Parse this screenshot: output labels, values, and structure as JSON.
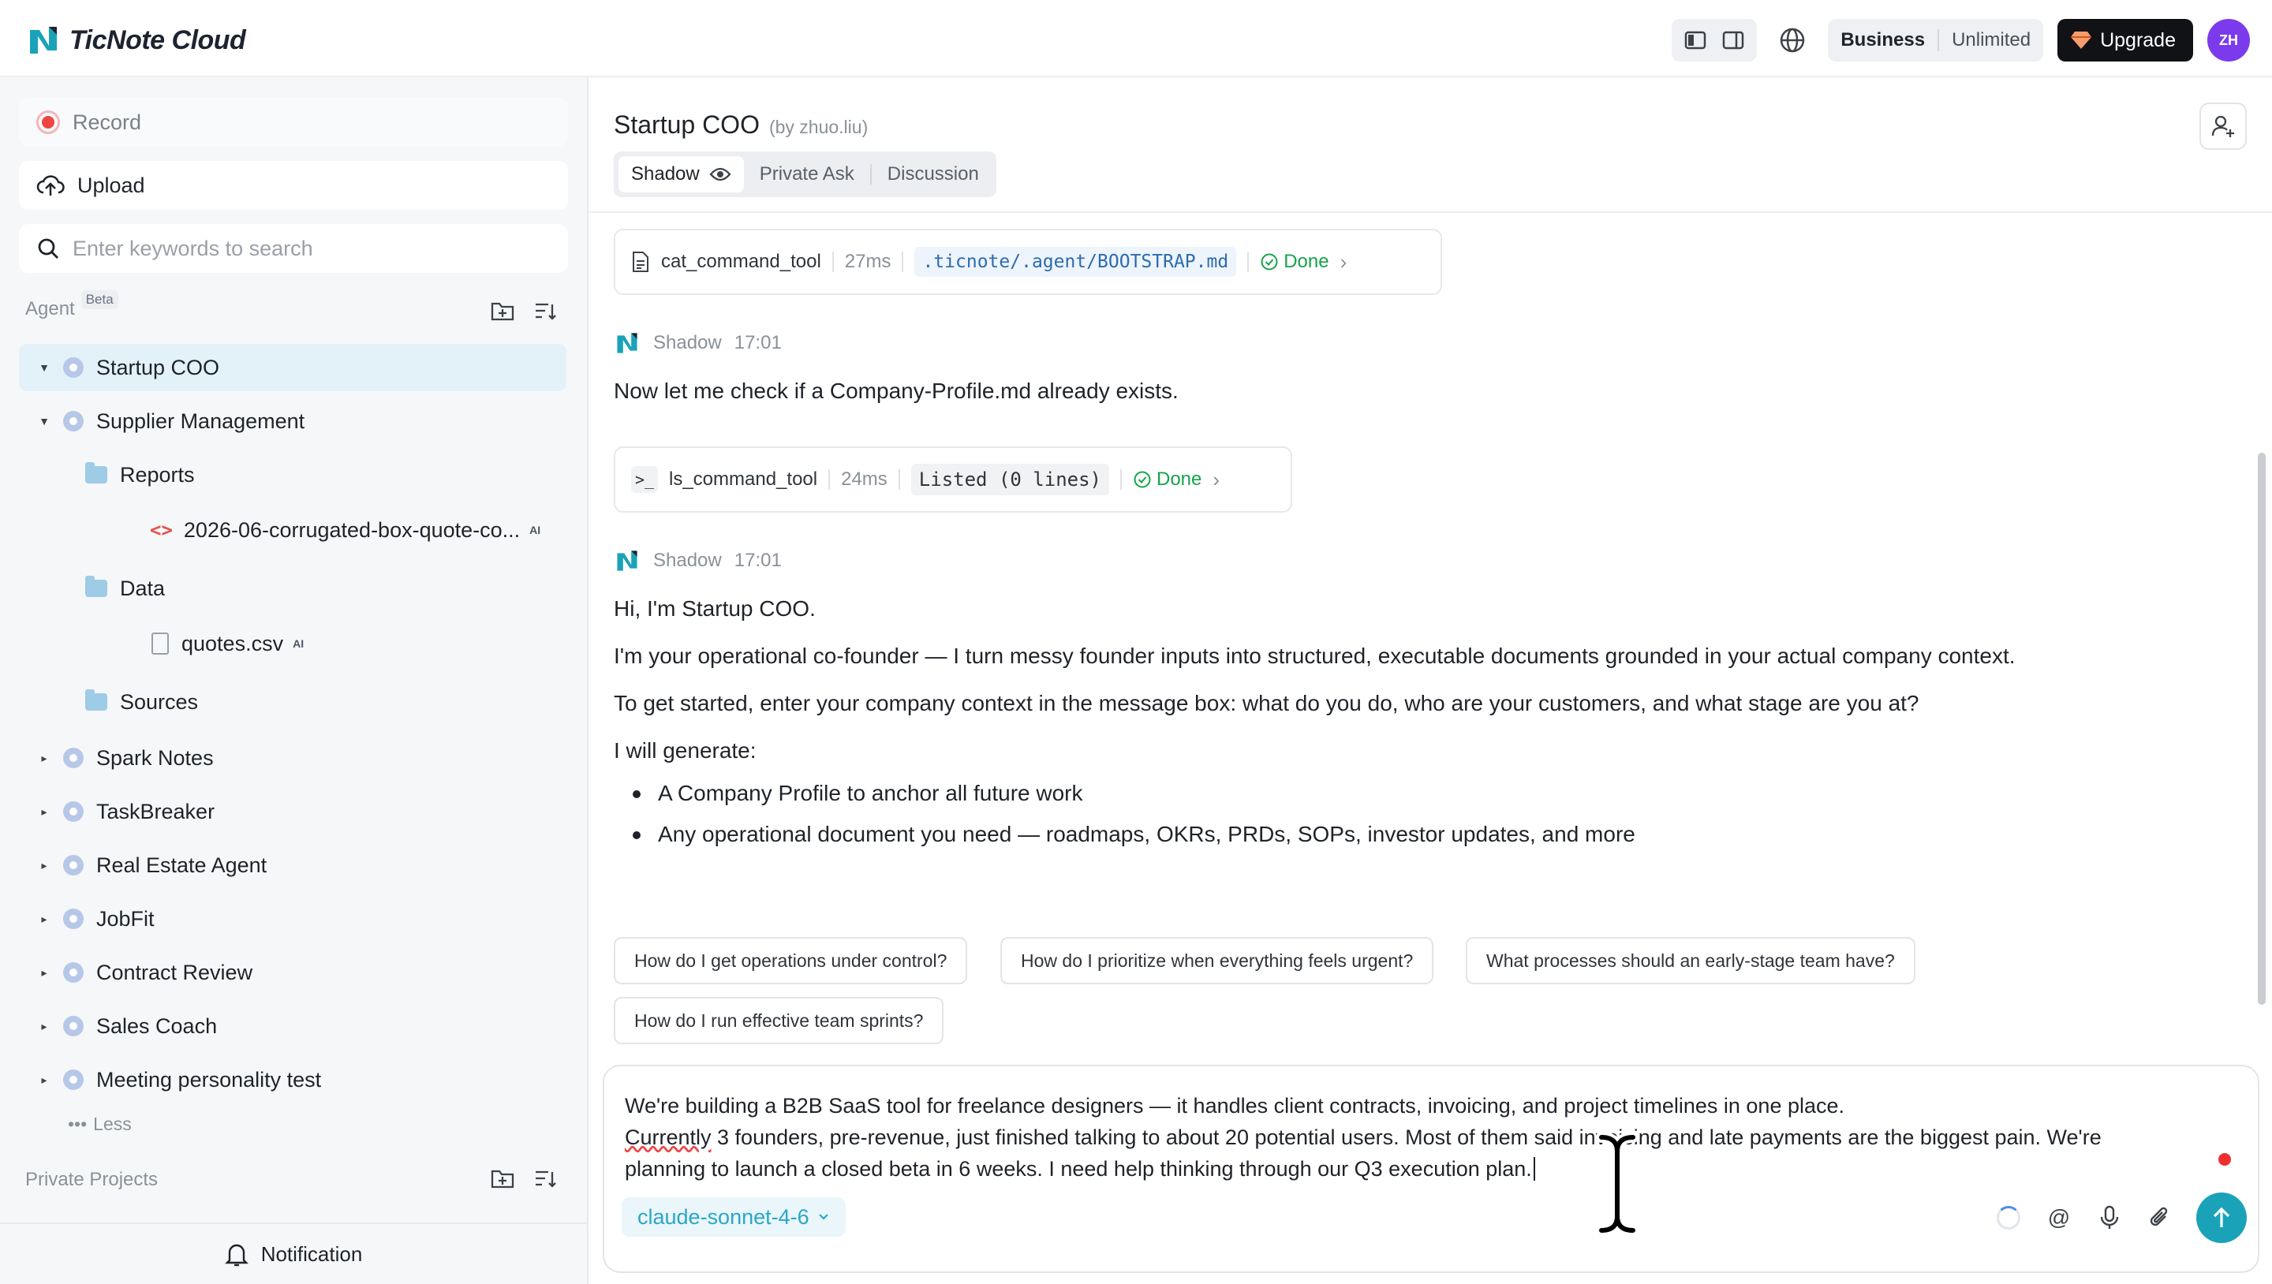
{
  "app": {
    "logo_text": "TicNote Cloud",
    "accent_color": "#1aa3b8"
  },
  "topbar": {
    "plan": "Business",
    "plan_tier": "Unlimited",
    "upgrade_label": "Upgrade",
    "avatar_initials": "ZH"
  },
  "sidebar": {
    "record_label": "Record",
    "upload_label": "Upload",
    "search_placeholder": "Enter keywords to search",
    "agent_section": "Agent",
    "beta_badge": "Beta",
    "tree": [
      {
        "label": "Startup COO",
        "type": "agent",
        "expanded": true,
        "active": true
      },
      {
        "label": "Supplier Management",
        "type": "agent",
        "expanded": true
      },
      {
        "label": "Reports",
        "type": "folder"
      },
      {
        "label": "2026-06-corrugated-box-quote-co...",
        "type": "code",
        "badge": "AI"
      },
      {
        "label": "Data",
        "type": "folder"
      },
      {
        "label": "quotes.csv",
        "type": "file",
        "badge": "AI"
      },
      {
        "label": "Sources",
        "type": "folder"
      },
      {
        "label": "Spark Notes",
        "type": "agent"
      },
      {
        "label": "TaskBreaker",
        "type": "agent"
      },
      {
        "label": "Real Estate Agent",
        "type": "agent"
      },
      {
        "label": "JobFit",
        "type": "agent"
      },
      {
        "label": "Contract Review",
        "type": "agent"
      },
      {
        "label": "Sales Coach",
        "type": "agent"
      },
      {
        "label": "Meeting personality test",
        "type": "agent"
      }
    ],
    "less_label": "Less",
    "private_section": "Private Projects",
    "notification_label": "Notification"
  },
  "chat": {
    "title": "Startup COO",
    "author": "(by zhuo.liu)",
    "tabs": [
      "Shadow",
      "Private Ask",
      "Discussion"
    ],
    "tool_calls": [
      {
        "name": "cat_command_tool",
        "duration": "27ms",
        "detail": ".ticnote/.agent/BOOTSTRAP.md",
        "status": "Done"
      },
      {
        "name": "ls_command_tool",
        "duration": "24ms",
        "detail": "Listed (0 lines)",
        "status": "Done"
      }
    ],
    "messages": [
      {
        "sender": "Shadow",
        "time": "17:01",
        "text": "Now let me check if a Company-Profile.md already exists."
      },
      {
        "sender": "Shadow",
        "time": "17:01"
      }
    ],
    "intro": {
      "line1": "Hi, I'm Startup COO.",
      "line2": "I'm your operational co-founder — I turn messy founder inputs into structured, executable documents grounded in your actual company context.",
      "line3": "To get started, enter your company context in the message box: what do you do, who are your customers, and what stage are you at?",
      "line4": "I will generate:",
      "bullets": [
        "A Company Profile to anchor all future work",
        "Any operational document you need — roadmaps, OKRs, PRDs, SOPs, investor updates, and more"
      ]
    },
    "suggestions": [
      "How do I get operations under control?",
      "How do I prioritize when everything feels urgent?",
      "What processes should an early-stage team have?",
      "How do I run effective team sprints?"
    ]
  },
  "composer": {
    "line1": "We're building a B2B SaaS tool for freelance designers — it handles client contracts, invoicing, and project timelines in one place.",
    "line2_first_word": "Currently",
    "line2_rest": " 3 founders, pre-revenue, just finished talking to about 20 potential users. Most of them said invoicing and late payments are the biggest pain. We're",
    "line3": "planning to launch a closed beta in 6 weeks. I need help thinking through our Q3 execution plan.",
    "model": "claude-sonnet-4-6",
    "at_symbol": "@"
  }
}
